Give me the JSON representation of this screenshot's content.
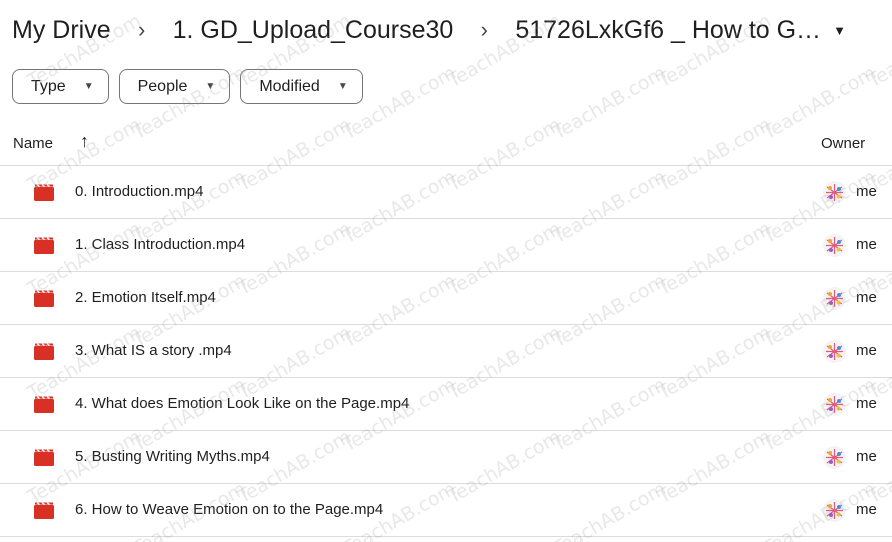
{
  "breadcrumb": {
    "items": [
      "My Drive",
      "1. GD_Upload_Course30"
    ],
    "separator": "›",
    "current": "51726LxkGf6 _ How to G…"
  },
  "filters": [
    {
      "label": "Type"
    },
    {
      "label": "People"
    },
    {
      "label": "Modified"
    }
  ],
  "table": {
    "headers": {
      "name": "Name",
      "owner": "Owner"
    },
    "sort_icon": "arrow-up-icon",
    "rows": [
      {
        "name": "0. Introduction.mp4",
        "owner": "me",
        "icon": "video-file-icon"
      },
      {
        "name": "1. Class Introduction.mp4",
        "owner": "me",
        "icon": "video-file-icon"
      },
      {
        "name": "2. Emotion Itself.mp4",
        "owner": "me",
        "icon": "video-file-icon"
      },
      {
        "name": "3. What IS a story .mp4",
        "owner": "me",
        "icon": "video-file-icon"
      },
      {
        "name": "4. What does Emotion Look Like on the Page.mp4",
        "owner": "me",
        "icon": "video-file-icon"
      },
      {
        "name": "5. Busting Writing Myths.mp4",
        "owner": "me",
        "icon": "video-file-icon"
      },
      {
        "name": "6. How to Weave Emotion on to the Page.mp4",
        "owner": "me",
        "icon": "video-file-icon"
      }
    ]
  },
  "watermark": "TeachAB.com",
  "colors": {
    "video_icon": "#d93025",
    "border": "#dadce0",
    "text": "#1f1f1f",
    "chip_border": "#747775"
  }
}
